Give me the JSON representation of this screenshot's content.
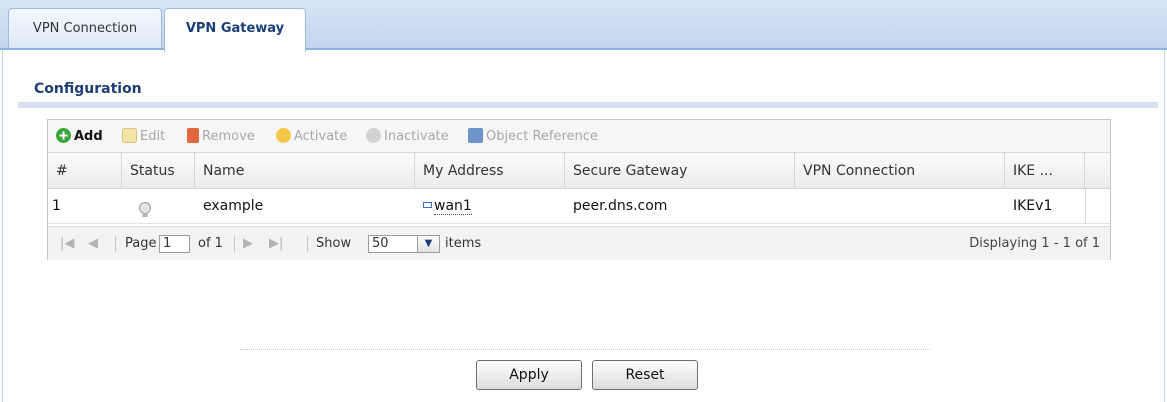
{
  "tabs": [
    {
      "label": "VPN Connection",
      "active": false
    },
    {
      "label": "VPN Gateway",
      "active": true
    }
  ],
  "section": {
    "title": "Configuration"
  },
  "toolbar": {
    "add": "Add",
    "edit": "Edit",
    "remove": "Remove",
    "activate": "Activate",
    "inactivate": "Inactivate",
    "object_reference": "Object Reference"
  },
  "table": {
    "columns": [
      "#",
      "Status",
      "Name",
      "My Address",
      "Secure Gateway",
      "VPN Connection",
      "IKE ..."
    ],
    "rows": [
      {
        "index": "1",
        "status_icon": "bulb-off-icon",
        "name": "example",
        "my_address": "wan1",
        "secure_gateway": "peer.dns.com",
        "vpn_connection": "",
        "ike": "IKEv1"
      }
    ]
  },
  "pager": {
    "page_label": "Page",
    "page_value": "1",
    "of_label": "of 1",
    "show_label": "Show",
    "show_value": "50",
    "items_label": "items",
    "displaying": "Displaying 1 - 1 of 1"
  },
  "buttons": {
    "apply": "Apply",
    "reset": "Reset"
  },
  "colors": {
    "accent": "#1d3e75",
    "tab_strip": "#c3d5ee",
    "add_icon": "#3aa63a"
  }
}
